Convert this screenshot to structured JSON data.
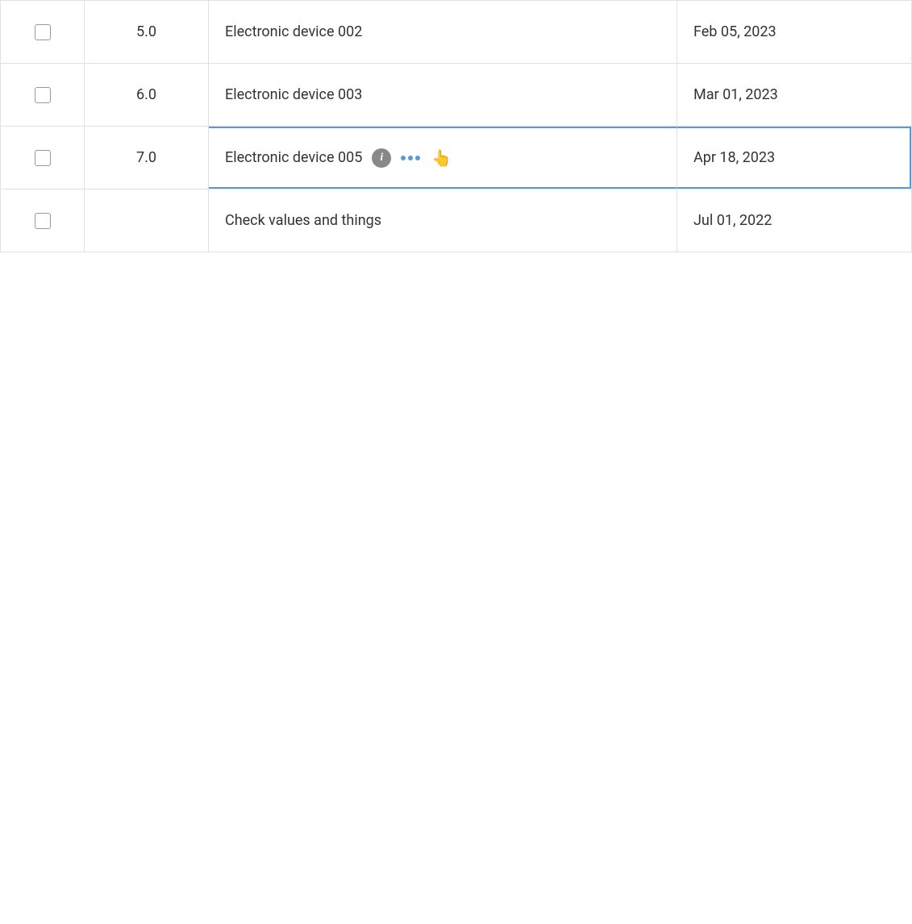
{
  "table": {
    "rows": [
      {
        "id": "row-1",
        "number": "5.0",
        "name": "Electronic device 002",
        "date": "Feb 05, 2023",
        "checked": false,
        "highlighted": false,
        "hasInfo": false,
        "hasDots": false
      },
      {
        "id": "row-2",
        "number": "6.0",
        "name": "Electronic device 003",
        "date": "Mar 01, 2023",
        "checked": false,
        "highlighted": false,
        "hasInfo": false,
        "hasDots": false
      },
      {
        "id": "row-3",
        "number": "7.0",
        "name": "Electronic device 005",
        "date": "Apr 18, 2023",
        "checked": false,
        "highlighted": true,
        "hasInfo": true,
        "hasDots": true
      },
      {
        "id": "row-4",
        "number": "",
        "name": "Check values and things",
        "date": "Jul 01, 2022",
        "checked": false,
        "highlighted": false,
        "hasInfo": false,
        "hasDots": false
      }
    ],
    "info_icon_label": "i",
    "dots_count": 3
  }
}
